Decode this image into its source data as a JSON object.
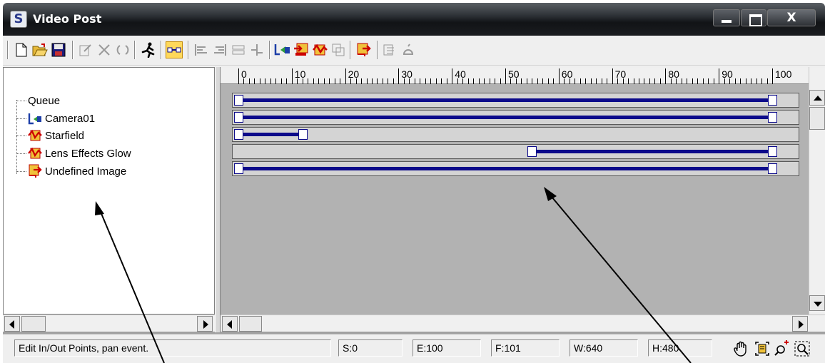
{
  "window": {
    "title": "Video Post",
    "app_icon": "S"
  },
  "window_controls": {
    "close_glyph": "X"
  },
  "toolbar": {
    "tools": [
      "new-sequence",
      "open-sequence",
      "save-sequence",
      "edit-current-event",
      "delete-current-event",
      "swap-events",
      "execute-sequence",
      "edit-range-bar",
      "align-left",
      "align-right",
      "make-same-size",
      "abut-selected",
      "add-scene-event",
      "add-image-input-event",
      "add-image-filter-event",
      "add-image-layer-event",
      "add-image-output-event",
      "add-external-event",
      "add-loop-event"
    ]
  },
  "queue": {
    "root": "Queue",
    "items": [
      {
        "label": "Camera01",
        "icon": "camera-scene-icon"
      },
      {
        "label": "Starfield",
        "icon": "image-filter-icon"
      },
      {
        "label": "Lens Effects Glow",
        "icon": "image-filter-icon"
      },
      {
        "label": "Undefined Image",
        "icon": "image-output-icon"
      }
    ]
  },
  "ruler": {
    "labels": [
      "0",
      "10",
      "20",
      "30",
      "40",
      "50",
      "60",
      "70",
      "80",
      "90",
      "100"
    ]
  },
  "tracks": [
    {
      "start": 0,
      "end": 100
    },
    {
      "start": 0,
      "end": 100
    },
    {
      "start": 0,
      "end": 12
    },
    {
      "start": 55,
      "end": 100
    },
    {
      "start": 0,
      "end": 100
    }
  ],
  "statusbar": {
    "message": "Edit In/Out Points, pan event.",
    "start": "S:0",
    "end": "E:100",
    "frames": "F:101",
    "width": "W:640",
    "height": "H:480"
  },
  "colors": {
    "range_bar": "#0c0a8a",
    "track_bg": "#d4d4d4",
    "timeline_bg": "#b2b2b2",
    "active_tool": "#ffd85a"
  }
}
